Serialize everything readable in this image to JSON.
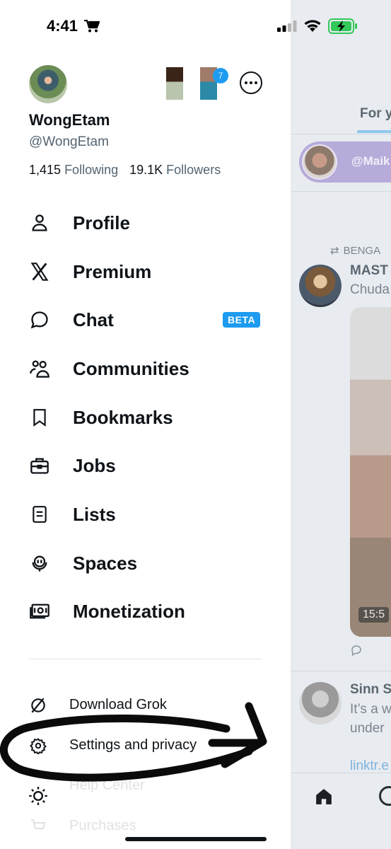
{
  "status_bar": {
    "time": "4:41",
    "icons": [
      "cart-icon",
      "signal-icon",
      "wifi-icon",
      "battery-charging-icon"
    ],
    "battery_color": "#34c759"
  },
  "drawer": {
    "display_name": "WongEtam",
    "handle": "@WongEtam",
    "following_count": "1,415",
    "following_label": "Following",
    "followers_count": "19.1K",
    "followers_label": "Followers",
    "other_account_badge": "7",
    "menu": [
      {
        "label": "Profile",
        "icon": "person-icon"
      },
      {
        "label": "Premium",
        "icon": "x-logo-icon"
      },
      {
        "label": "Chat",
        "icon": "chat-bubble-icon",
        "badge": "BETA"
      },
      {
        "label": "Communities",
        "icon": "communities-icon"
      },
      {
        "label": "Bookmarks",
        "icon": "bookmark-icon"
      },
      {
        "label": "Jobs",
        "icon": "briefcase-icon"
      },
      {
        "label": "Lists",
        "icon": "list-icon"
      },
      {
        "label": "Spaces",
        "icon": "microphone-icon"
      },
      {
        "label": "Monetization",
        "icon": "money-icon"
      }
    ],
    "bottom": [
      {
        "label": "Download Grok",
        "icon": "grok-icon"
      },
      {
        "label": "Settings and privacy",
        "icon": "gear-icon"
      },
      {
        "label": "Help Center",
        "icon": "help-icon"
      },
      {
        "label": "Purchases",
        "icon": "cart-icon"
      }
    ],
    "accent_color": "#1d9bf0"
  },
  "feed": {
    "tab_label": "For y",
    "spaces_handle": "@Maik",
    "repost_label": "BENGA",
    "post1_name": "MAST",
    "post1_text": "Chuda",
    "post1_time": "15:5",
    "post2_name": "Sinn S",
    "post2_line1": "It’s a w",
    "post2_line2": "under",
    "post2_link": "linktr.e"
  }
}
